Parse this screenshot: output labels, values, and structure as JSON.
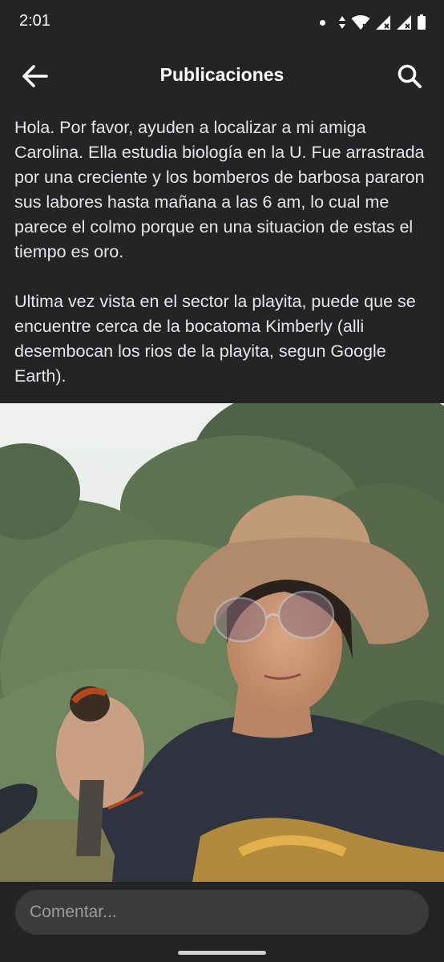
{
  "status_bar": {
    "time": "2:01",
    "icons": [
      "notification-dot-icon",
      "data-arrows-icon",
      "wifi-icon",
      "signal-icon",
      "signal-icon",
      "battery-icon"
    ]
  },
  "app_bar": {
    "title": "Publicaciones",
    "back_icon": "arrow-left-icon",
    "search_icon": "search-icon"
  },
  "post": {
    "paragraph_1": "Hola. Por favor, ayuden a localizar a mi amiga Carolina. Ella estudia biología en la U. Fue arrastrada por una creciente y los bomberos de barbosa pararon sus labores hasta mañana a las 6 am, lo cual me parece el colmo porque en una situacion de estas el tiempo es oro.",
    "paragraph_2": "Ultima vez vista en el sector la playita, puede que se encuentre cerca de la bocatoma Kimberly (alli desembocan los rios de la playita, segun Google Earth)."
  },
  "photo": {
    "subject": "woman-with-hat-holding-bird-photo"
  },
  "comment": {
    "placeholder": "Comentar..."
  },
  "colors": {
    "background": "#232426",
    "text": "#e4e6eb",
    "input_bg": "#3a3b3c"
  }
}
